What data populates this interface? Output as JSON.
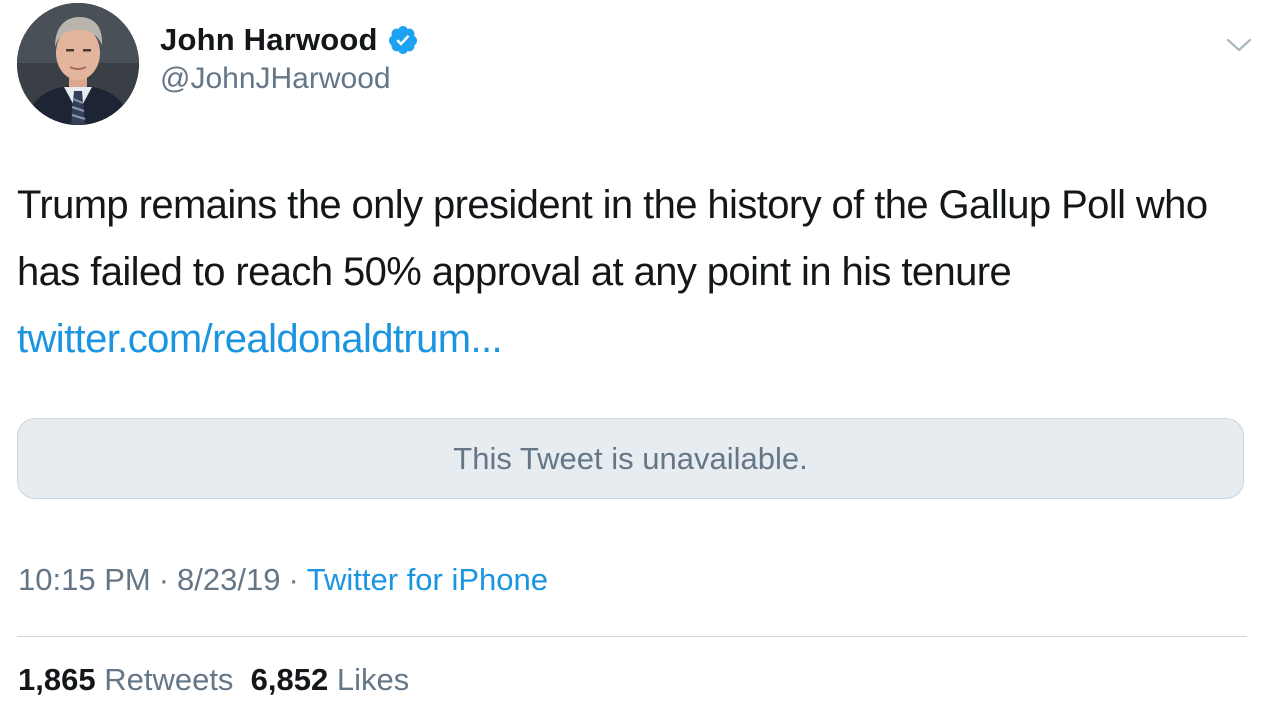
{
  "author": {
    "display_name": "John Harwood",
    "handle": "@JohnJHarwood",
    "verified": true,
    "avatar_icon": "person-photo-avatar"
  },
  "tweet": {
    "text_before_link": "Trump remains the only president in the history of the Gallup Poll who has failed to reach 50% approval at any point in his tenure ",
    "link_text": "twitter.com/realdonaldtrum..."
  },
  "quoted": {
    "unavailable_text": "This Tweet is unavailable."
  },
  "meta": {
    "time": "10:15 PM",
    "date": "8/23/19",
    "source": "Twitter for iPhone",
    "separator": "·"
  },
  "stats": {
    "retweets_count": "1,865",
    "retweets_label": "Retweets",
    "likes_count": "6,852",
    "likes_label": "Likes"
  },
  "colors": {
    "link": "#1b95e0",
    "secondary_text": "#657786",
    "primary_text": "#14171a",
    "quote_bg": "#e6ecf0",
    "verified_badge": "#1da1f2"
  }
}
